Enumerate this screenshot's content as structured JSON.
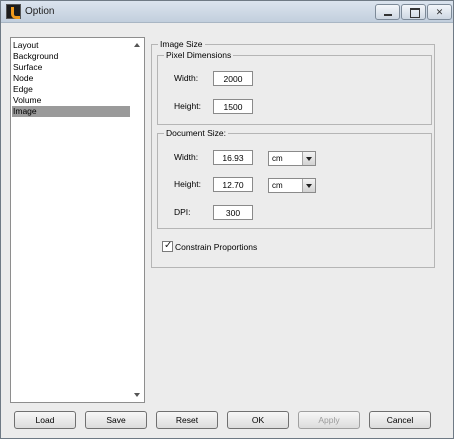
{
  "window": {
    "title": "Option"
  },
  "list": {
    "items": [
      {
        "label": "Layout"
      },
      {
        "label": "Background"
      },
      {
        "label": "Surface"
      },
      {
        "label": "Node"
      },
      {
        "label": "Edge"
      },
      {
        "label": "Volume"
      },
      {
        "label": "Image"
      }
    ],
    "selected": "Image"
  },
  "image_size": {
    "title": "Image Size",
    "pixel_dimensions": {
      "title": "Pixel Dimensions",
      "width_label": "Width:",
      "width_value": "2000",
      "height_label": "Height:",
      "height_value": "1500"
    },
    "document_size": {
      "title": "Document Size:",
      "width_label": "Width:",
      "width_value": "16.93",
      "width_unit": "cm",
      "height_label": "Height:",
      "height_value": "12.70",
      "height_unit": "cm",
      "dpi_label": "DPI:",
      "dpi_value": "300"
    },
    "constrain_label": "Constrain Proportions",
    "constrain_checked": true
  },
  "buttons": {
    "load": "Load",
    "save": "Save",
    "reset": "Reset",
    "ok": "OK",
    "apply": "Apply",
    "cancel": "Cancel"
  }
}
